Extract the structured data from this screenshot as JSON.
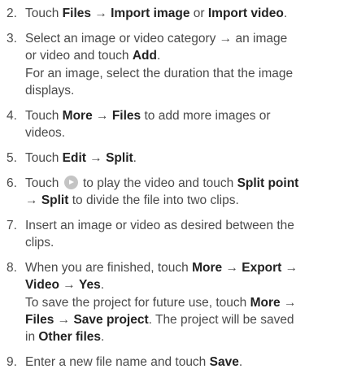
{
  "arrow": "→",
  "steps": [
    {
      "num": "2.",
      "a": "Touch ",
      "b": "Files",
      "c": " ",
      "d": "Import image",
      "e": " or ",
      "f": "Import video",
      "g": "."
    },
    {
      "num": "3.",
      "l1": "Select an image or video category ",
      "l1b": " an image",
      "l2": "or video and touch ",
      "l2b": "Add",
      "l2c": ".",
      "n1": "For an image, select the duration that the image",
      "n2": "displays."
    },
    {
      "num": "4.",
      "a": "Touch ",
      "b": "More",
      "c": " ",
      "d": "Files",
      "e": " to add more images or",
      "l2": "videos."
    },
    {
      "num": "5.",
      "a": "Touch ",
      "b": "Edit",
      "c": " ",
      "d": "Split",
      "e": "."
    },
    {
      "num": "6.",
      "a": "Touch ",
      "icon": "play-icon",
      "c": " to play the video and touch ",
      "d": "Split point",
      "l2b": "Split",
      "l2c": " to divide the file into two clips."
    },
    {
      "num": "7.",
      "l1": "Insert an image or video as desired between the",
      "l2": "clips."
    },
    {
      "num": "8.",
      "a": "When you are finished, touch ",
      "b": "More",
      "d": "Export",
      "l2b1": "Video",
      "l2b2": "Yes",
      "l2c": ".",
      "n1a": "To save the project for future use, touch ",
      "n1b": "More",
      "n2b1": "Files",
      "n2b2": "Save project",
      "n2c": ". The project will be saved",
      "n3a": "in ",
      "n3b": "Other files",
      "n3c": "."
    },
    {
      "num": "9.",
      "a": "Enter a new file name and touch ",
      "b": "Save",
      "c": "."
    }
  ]
}
